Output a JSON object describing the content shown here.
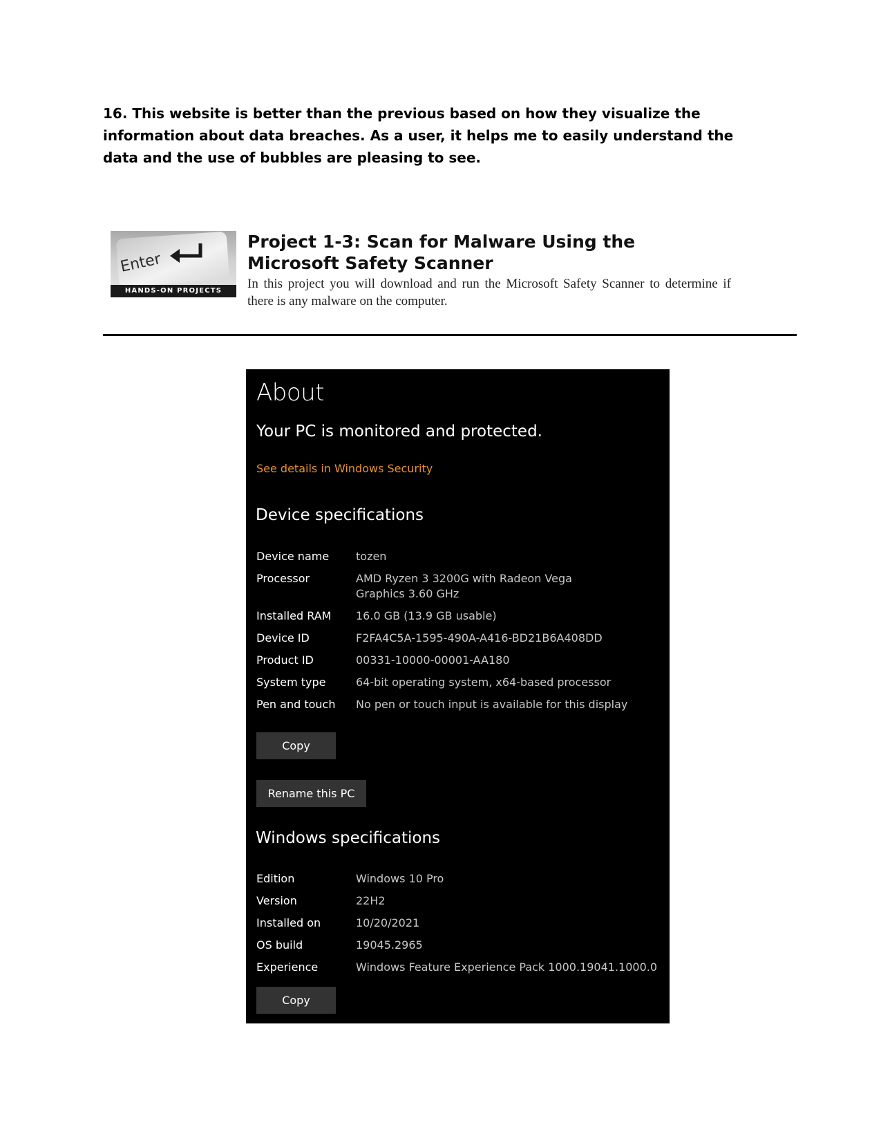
{
  "answer": {
    "text": "16. This website is better than the previous based on how they visualize the information about data breaches. As a user, it helps me to easily understand the data and the use of bubbles are pleasing to see."
  },
  "project": {
    "badge_key_text": "Enter",
    "badge_caption": "HANDS-ON PROJECTS",
    "title": "Project 1-3: Scan for Malware Using the Microsoft Safety Scanner",
    "description": "In this project you will download and run the Microsoft Safety Scanner to determine if there is any malware on the computer."
  },
  "about": {
    "title": "About",
    "status": "Your PC is monitored and protected.",
    "security_link": "See details in Windows Security",
    "link_color": "#e8912d",
    "device_heading": "Device specifications",
    "device_specs": [
      {
        "label": "Device name",
        "value": "tozen"
      },
      {
        "label": "Processor",
        "value": "AMD Ryzen 3 3200G with Radeon Vega Graphics 3.60 GHz"
      },
      {
        "label": "Installed RAM",
        "value": "16.0 GB (13.9 GB usable)"
      },
      {
        "label": "Device ID",
        "value": "F2FA4C5A-1595-490A-A416-BD21B6A408DD"
      },
      {
        "label": "Product ID",
        "value": "00331-10000-00001-AA180"
      },
      {
        "label": "System type",
        "value": "64-bit operating system, x64-based processor"
      },
      {
        "label": "Pen and touch",
        "value": "No pen or touch input is available for this display"
      }
    ],
    "copy_label": "Copy",
    "rename_label": "Rename this PC",
    "windows_heading": "Windows specifications",
    "windows_specs": [
      {
        "label": "Edition",
        "value": "Windows 10 Pro"
      },
      {
        "label": "Version",
        "value": "22H2"
      },
      {
        "label": "Installed on",
        "value": "10/20/2021"
      },
      {
        "label": "OS build",
        "value": "19045.2965"
      },
      {
        "label": "Experience",
        "value": "Windows Feature Experience Pack 1000.19041.1000.0"
      }
    ],
    "copy_label_2": "Copy"
  }
}
